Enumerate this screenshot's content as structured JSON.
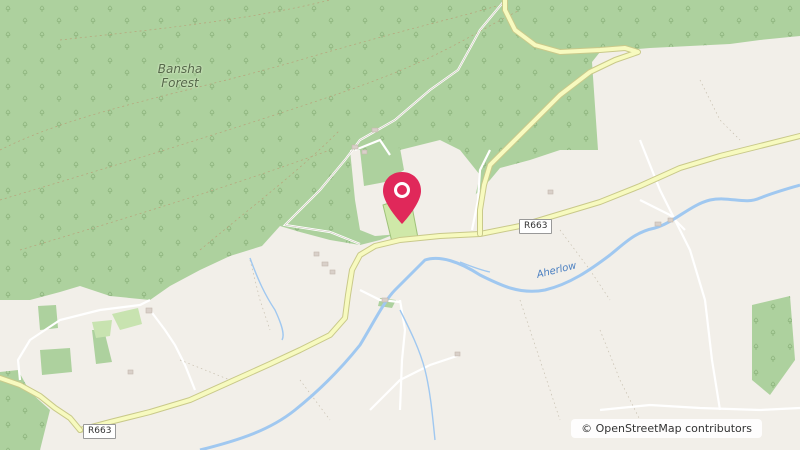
{
  "map": {
    "place_label_line1": "Bansha",
    "place_label_line2": "Forest",
    "road_label_1": "R663",
    "road_label_2": "R663",
    "river_label": "Aherlow",
    "attribution": "© OpenStreetMap contributors",
    "marker_icon": "map-pin-icon",
    "colors": {
      "land": "#f2efe9",
      "forest": "#add19e",
      "road_fill": "#f7fabf",
      "road_casing": "#c9c98a",
      "river": "#a0c8f0",
      "marker": "#e0285a"
    }
  }
}
